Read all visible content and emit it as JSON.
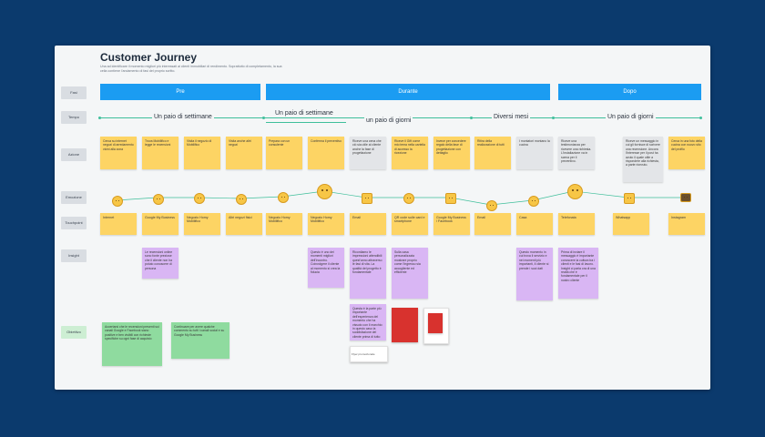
{
  "board": {
    "title": "Customer Journey",
    "subtitle": "Una ad identificare il momento migliori più interessati ai clienti immobiliari di rendimento. Soprattutto di completamento, la sua cella contiene l'andamento di fasi del proprio scritto."
  },
  "row_labels": [
    "Fasi",
    "Tempo",
    "Azione",
    "Emozione",
    "Touchpoint",
    "Insight",
    "Obiettivo"
  ],
  "phases": [
    "Pre",
    "Durante",
    "Dopo"
  ],
  "timeline": [
    "Un paio di settimane",
    "Un paio di settimane",
    "un paio di giorni",
    "Diversi mesi",
    "Un paio di giorni"
  ],
  "actions": [
    {
      "text": "Cerca su internet negozi di arredamento vicini alla zona",
      "color": "yellow"
    },
    {
      "text": "Trova Mobilifico e legge le recensioni",
      "color": "yellow"
    },
    {
      "text": "Visita il negozio di Mobilifico",
      "color": "yellow"
    },
    {
      "text": "Visita anche altri negozi",
      "color": "yellow"
    },
    {
      "text": "Prepara con un consulente",
      "color": "yellow"
    },
    {
      "text": "Conferma il preventivo",
      "color": "yellow"
    },
    {
      "text": "Riceve una cena che ciò sia utile al cliente anche la fase di progettazione",
      "color": "gray"
    },
    {
      "text": "Riceve il Gift come mio tema nella cartella di accesso la ricezione",
      "color": "yellow"
    },
    {
      "text": "Invece per concedere regalo della fase di progettazione con dettaglio",
      "color": "yellow"
    },
    {
      "text": "Ritira della realizzazione di tutti",
      "color": "yellow"
    },
    {
      "text": "I montatori montano la cucina",
      "color": "gray"
    },
    {
      "text": "Riceve una testimonianza per ricevere una richiesta. L'installazione va in scena per il preventivo.",
      "color": "gray"
    },
    {
      "text": "Riceve un messaggio in cui gli fornisce di scrivere una recensione. Ancora l'interesse per il post ha avuto il quale utile a rispondere alla richiesta, a parte ricevuto.",
      "color": "gray"
    },
    {
      "text": "Cerca in una foto della cucina con nuovo sito del profilo",
      "color": "yellow"
    }
  ],
  "touchpoints": [
    "Internet",
    "Google My Business",
    "Negozio Homy Mobilifico",
    "Altri negozi fisici",
    "Negozio Homy Mobilifico",
    "Negozio Homy Mobilifico",
    "Email",
    "QR code sulle card e smartphone",
    "Google My Business / Facebook",
    "Email",
    "Casa",
    "Telefonata",
    "Whatsapp",
    "Instagram"
  ],
  "insights": [
    "Le recensioni online sono fonte preziose che il cliente non ha potuto conoscere di persona",
    "Questo è uno dei momenti migliori dell'incontro. Coinvolgere il cliente al momento si crea la fiducia",
    "Ricordiamo le impressioni attendibili quest'anno attraverso le fasi di vita. La qualità del progetto è fondamentale",
    "Sulla casa personalizzata mostrare proprio come l'ingresso sia accogliente ed efficiente",
    "Questo momento in cui trova il servizio e nei momenti più importanti, il cliente si prende i suoi dati"
  ],
  "insight_extra": "Questa è la parte più importante dell'esperienza del momento che ha vissuto con il marchio: in questo caso la soddisfazione del cliente prima di tutto",
  "insight_last": "Prima di inviare il messaggio è importante conoscere la cultura tra i clienti e le fasi di lavoro. Insight ci parla ora di una realtà che è fondamentale per il nostro cliente",
  "objectives": [
    "Accertarsi che le recensioni presenti sui canali Google e Facebook siano positive e ben visibili con richieste specifiche su ogni fase di acquisto",
    "Continuare per avere qualche commento su tutti i canali social e su Google My Business"
  ],
  "thumbnail_caption": "Flyer promozionale"
}
